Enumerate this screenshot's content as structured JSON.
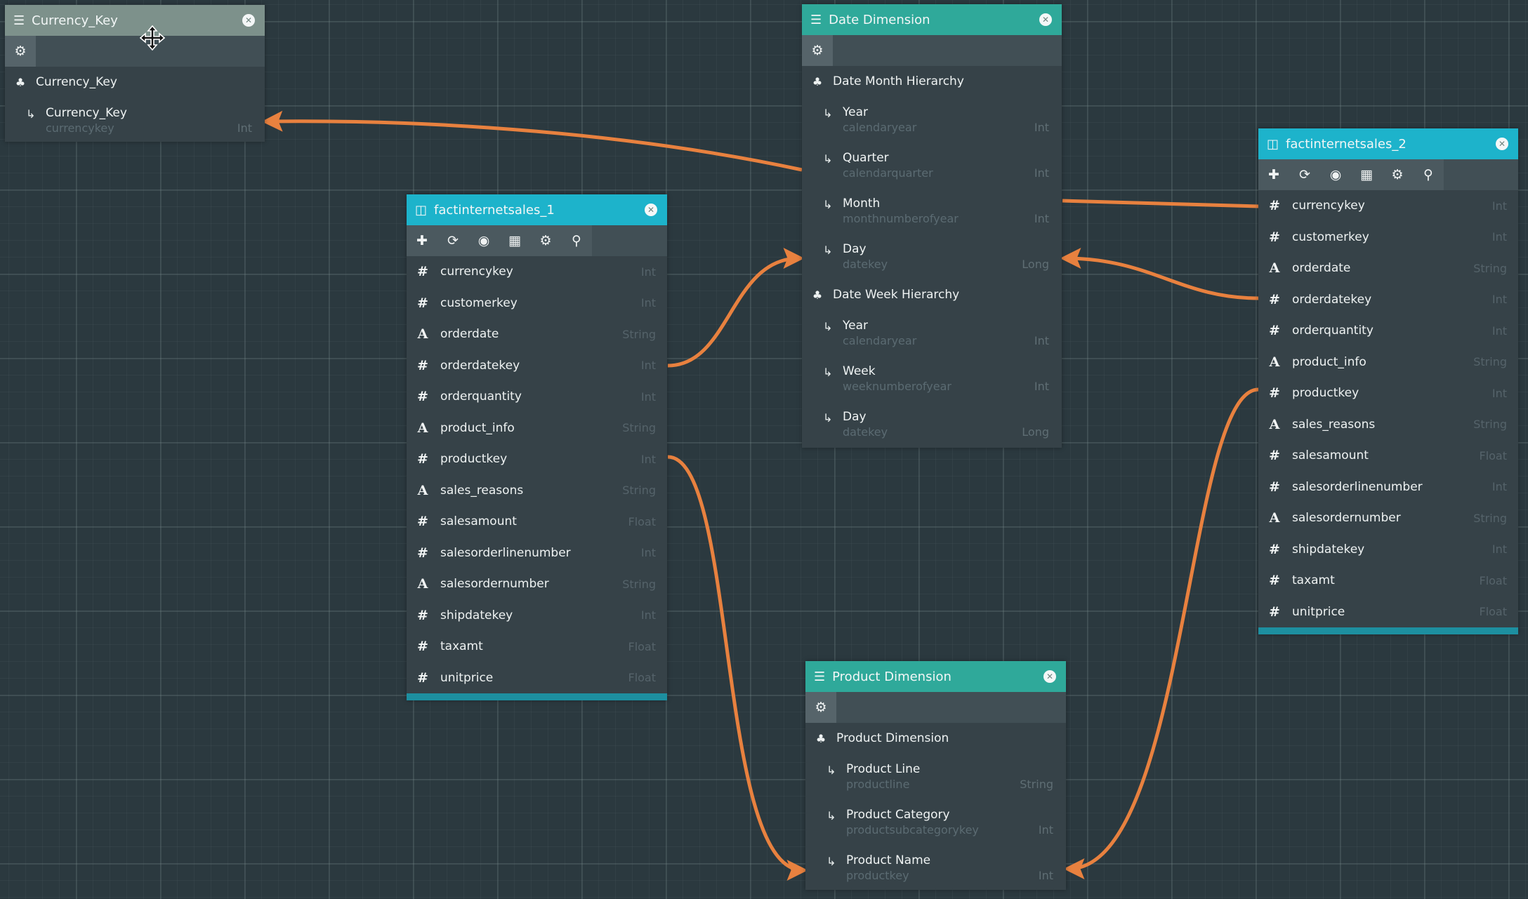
{
  "colors": {
    "connector": "#e8813f",
    "header_dimension": "#2fa99a",
    "header_fact": "#1db3cb",
    "header_dragging": "#7d918b"
  },
  "panels": {
    "currency_key": {
      "title": "Currency_Key",
      "title_icon": "list-icon",
      "toolbar": [
        "gear-icon"
      ],
      "hierarchies": [
        {
          "name": "Currency_Key",
          "levels": [
            {
              "name": "Currency_Key",
              "column": "currencykey",
              "type": "Int"
            }
          ]
        }
      ]
    },
    "date_dimension": {
      "title": "Date Dimension",
      "title_icon": "list-icon",
      "toolbar": [
        "gear-icon"
      ],
      "hierarchies": [
        {
          "name": "Date Month Hierarchy",
          "levels": [
            {
              "name": "Year",
              "column": "calendaryear",
              "type": "Int"
            },
            {
              "name": "Quarter",
              "column": "calendarquarter",
              "type": "Int"
            },
            {
              "name": "Month",
              "column": "monthnumberofyear",
              "type": "Int"
            },
            {
              "name": "Day",
              "column": "datekey",
              "type": "Long"
            }
          ]
        },
        {
          "name": "Date Week Hierarchy",
          "levels": [
            {
              "name": "Year",
              "column": "calendaryear",
              "type": "Int"
            },
            {
              "name": "Week",
              "column": "weeknumberofyear",
              "type": "Int"
            },
            {
              "name": "Day",
              "column": "datekey",
              "type": "Long"
            }
          ]
        }
      ]
    },
    "product_dimension": {
      "title": "Product Dimension",
      "title_icon": "list-icon",
      "toolbar": [
        "gear-icon"
      ],
      "hierarchies": [
        {
          "name": "Product Dimension",
          "levels": [
            {
              "name": "Product Line",
              "column": "productline",
              "type": "String"
            },
            {
              "name": "Product Category",
              "column": "productsubcategorykey",
              "type": "Int"
            },
            {
              "name": "Product Name",
              "column": "productkey",
              "type": "Int"
            }
          ]
        }
      ]
    },
    "fact_1": {
      "title": "factinternetsales_1",
      "title_icon": "table-icon",
      "toolbar": [
        "plus-icon",
        "refresh-icon",
        "eye-icon",
        "grid-icon",
        "gear-icon",
        "search-icon"
      ],
      "columns": [
        {
          "name": "currencykey",
          "type": "Int",
          "kind": "number"
        },
        {
          "name": "customerkey",
          "type": "Int",
          "kind": "number"
        },
        {
          "name": "orderdate",
          "type": "String",
          "kind": "text"
        },
        {
          "name": "orderdatekey",
          "type": "Int",
          "kind": "number"
        },
        {
          "name": "orderquantity",
          "type": "Int",
          "kind": "number"
        },
        {
          "name": "product_info",
          "type": "String",
          "kind": "text"
        },
        {
          "name": "productkey",
          "type": "Int",
          "kind": "number"
        },
        {
          "name": "sales_reasons",
          "type": "String",
          "kind": "text"
        },
        {
          "name": "salesamount",
          "type": "Float",
          "kind": "number"
        },
        {
          "name": "salesorderlinenumber",
          "type": "Int",
          "kind": "number"
        },
        {
          "name": "salesordernumber",
          "type": "String",
          "kind": "text"
        },
        {
          "name": "shipdatekey",
          "type": "Int",
          "kind": "number"
        },
        {
          "name": "taxamt",
          "type": "Float",
          "kind": "number"
        },
        {
          "name": "unitprice",
          "type": "Float",
          "kind": "number"
        }
      ]
    },
    "fact_2": {
      "title": "factinternetsales_2",
      "title_icon": "table-icon",
      "toolbar": [
        "plus-icon",
        "refresh-icon",
        "eye-icon",
        "grid-icon",
        "gear-icon",
        "search-icon"
      ],
      "columns": [
        {
          "name": "currencykey",
          "type": "Int",
          "kind": "number"
        },
        {
          "name": "customerkey",
          "type": "Int",
          "kind": "number"
        },
        {
          "name": "orderdate",
          "type": "String",
          "kind": "text"
        },
        {
          "name": "orderdatekey",
          "type": "Int",
          "kind": "number"
        },
        {
          "name": "orderquantity",
          "type": "Int",
          "kind": "number"
        },
        {
          "name": "product_info",
          "type": "String",
          "kind": "text"
        },
        {
          "name": "productkey",
          "type": "Int",
          "kind": "number"
        },
        {
          "name": "sales_reasons",
          "type": "String",
          "kind": "text"
        },
        {
          "name": "salesamount",
          "type": "Float",
          "kind": "number"
        },
        {
          "name": "salesorderlinenumber",
          "type": "Int",
          "kind": "number"
        },
        {
          "name": "salesordernumber",
          "type": "String",
          "kind": "text"
        },
        {
          "name": "shipdatekey",
          "type": "Int",
          "kind": "number"
        },
        {
          "name": "taxamt",
          "type": "Float",
          "kind": "number"
        },
        {
          "name": "unitprice",
          "type": "Float",
          "kind": "number"
        }
      ]
    }
  },
  "links": [
    {
      "from": "date_dimension",
      "to": "currency_key.Currency_Key"
    },
    {
      "from": "factinternetsales_1.orderdatekey",
      "to": "date_dimension.Day"
    },
    {
      "from": "factinternetsales_2.currencykey",
      "to": "date_dimension"
    },
    {
      "from": "factinternetsales_2.orderdatekey",
      "to": "date_dimension.Day"
    },
    {
      "from": "factinternetsales_1.productkey",
      "to": "product_dimension.Product Name"
    },
    {
      "from": "factinternetsales_2.productkey",
      "to": "product_dimension.Product Name"
    }
  ]
}
